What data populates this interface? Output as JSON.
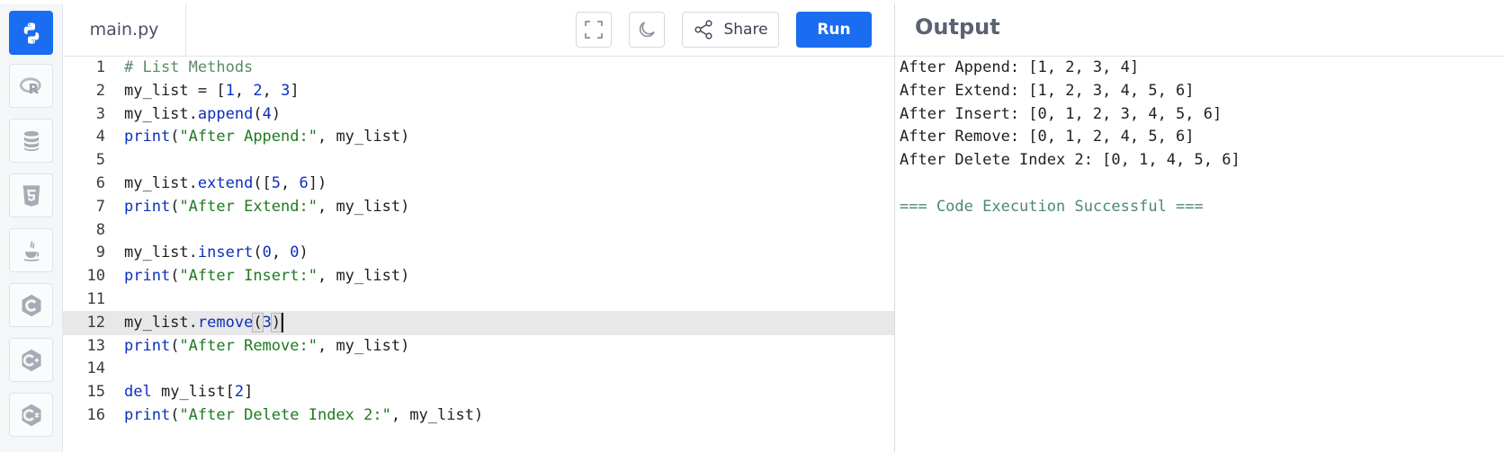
{
  "sidebar": {
    "languages": [
      {
        "name": "Python",
        "icon": "python-icon",
        "active": true
      },
      {
        "name": "R",
        "icon": "r-lang-icon"
      },
      {
        "name": "SQL",
        "icon": "database-icon"
      },
      {
        "name": "HTML",
        "icon": "html5-icon"
      },
      {
        "name": "Java",
        "icon": "java-icon"
      },
      {
        "name": "C",
        "icon": "c-lang-icon"
      },
      {
        "name": "C++",
        "icon": "cpp-lang-icon"
      },
      {
        "name": "C#",
        "icon": "csharp-lang-icon"
      }
    ],
    "active_color": "#1a6cf0"
  },
  "toolbar": {
    "file_tab": "main.py",
    "fullscreen_icon": "fullscreen-icon",
    "theme_icon": "moon-icon",
    "share_label": "Share",
    "share_icon": "share-icon",
    "run_label": "Run",
    "run_color": "#1a6cf0"
  },
  "editor": {
    "current_line": 12,
    "lines": [
      {
        "n": "1",
        "tokens": [
          [
            "comment",
            "# List Methods"
          ]
        ]
      },
      {
        "n": "2",
        "tokens": [
          [
            "plain",
            "my_list = ["
          ],
          [
            "num",
            "1"
          ],
          [
            "plain",
            ", "
          ],
          [
            "num",
            "2"
          ],
          [
            "plain",
            ", "
          ],
          [
            "num",
            "3"
          ],
          [
            "plain",
            "]"
          ]
        ]
      },
      {
        "n": "3",
        "tokens": [
          [
            "plain",
            "my_list."
          ],
          [
            "fn",
            "append"
          ],
          [
            "plain",
            "("
          ],
          [
            "num",
            "4"
          ],
          [
            "plain",
            ")"
          ]
        ]
      },
      {
        "n": "4",
        "tokens": [
          [
            "kw",
            "print"
          ],
          [
            "plain",
            "("
          ],
          [
            "str",
            "\"After Append:\""
          ],
          [
            "plain",
            ", my_list)"
          ]
        ]
      },
      {
        "n": "5",
        "tokens": []
      },
      {
        "n": "6",
        "tokens": [
          [
            "plain",
            "my_list."
          ],
          [
            "fn",
            "extend"
          ],
          [
            "plain",
            "(["
          ],
          [
            "num",
            "5"
          ],
          [
            "plain",
            ", "
          ],
          [
            "num",
            "6"
          ],
          [
            "plain",
            "])"
          ]
        ]
      },
      {
        "n": "7",
        "tokens": [
          [
            "kw",
            "print"
          ],
          [
            "plain",
            "("
          ],
          [
            "str",
            "\"After Extend:\""
          ],
          [
            "plain",
            ", my_list)"
          ]
        ]
      },
      {
        "n": "8",
        "tokens": []
      },
      {
        "n": "9",
        "tokens": [
          [
            "plain",
            "my_list."
          ],
          [
            "fn",
            "insert"
          ],
          [
            "plain",
            "("
          ],
          [
            "num",
            "0"
          ],
          [
            "plain",
            ", "
          ],
          [
            "num",
            "0"
          ],
          [
            "plain",
            ")"
          ]
        ]
      },
      {
        "n": "10",
        "tokens": [
          [
            "kw",
            "print"
          ],
          [
            "plain",
            "("
          ],
          [
            "str",
            "\"After Insert:\""
          ],
          [
            "plain",
            ", my_list)"
          ]
        ]
      },
      {
        "n": "11",
        "tokens": []
      },
      {
        "n": "12",
        "tokens": [
          [
            "plain",
            "my_list."
          ],
          [
            "fn",
            "remove"
          ],
          [
            "bracket",
            "("
          ],
          [
            "num",
            "3"
          ],
          [
            "bracket",
            ")"
          ],
          [
            "caret",
            ""
          ]
        ]
      },
      {
        "n": "13",
        "tokens": [
          [
            "kw",
            "print"
          ],
          [
            "plain",
            "("
          ],
          [
            "str",
            "\"After Remove:\""
          ],
          [
            "plain",
            ", my_list)"
          ]
        ]
      },
      {
        "n": "14",
        "tokens": []
      },
      {
        "n": "15",
        "tokens": [
          [
            "kw",
            "del"
          ],
          [
            "plain",
            " my_list["
          ],
          [
            "num",
            "2"
          ],
          [
            "plain",
            "]"
          ]
        ]
      },
      {
        "n": "16",
        "tokens": [
          [
            "kw",
            "print"
          ],
          [
            "plain",
            "("
          ],
          [
            "str",
            "\"After Delete Index 2:\""
          ],
          [
            "plain",
            ", my_list)"
          ]
        ]
      }
    ]
  },
  "output": {
    "title": "Output",
    "lines": [
      "After Append: [1, 2, 3, 4]",
      "After Extend: [1, 2, 3, 4, 5, 6]",
      "After Insert: [0, 1, 2, 3, 4, 5, 6]",
      "After Remove: [0, 1, 2, 4, 5, 6]",
      "After Delete Index 2: [0, 1, 4, 5, 6]",
      "",
      "=== Code Execution Successful ==="
    ],
    "success_color": "#4c8a6a"
  }
}
